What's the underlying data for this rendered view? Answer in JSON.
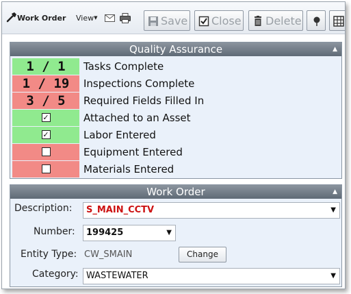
{
  "toolbar": {
    "title": "Work Order",
    "view_label": "View",
    "save_label": "Save",
    "close_label": "Close",
    "delete_label": "Delete"
  },
  "quality_assurance": {
    "title": "Quality Assurance",
    "rows": [
      {
        "value": "1 / 1",
        "label": "Tasks Complete",
        "status": "green",
        "kind": "count"
      },
      {
        "value": "1 / 19",
        "label": "Inspections Complete",
        "status": "red",
        "kind": "count"
      },
      {
        "value": "3 / 5",
        "label": "Required Fields Filled In",
        "status": "red",
        "kind": "count"
      },
      {
        "value": "☑",
        "label": "Attached to an Asset",
        "status": "green",
        "kind": "check",
        "checked": true
      },
      {
        "value": "☑",
        "label": "Labor Entered",
        "status": "green",
        "kind": "check",
        "checked": true
      },
      {
        "value": "☐",
        "label": "Equipment Entered",
        "status": "red",
        "kind": "check",
        "checked": false
      },
      {
        "value": "☐",
        "label": "Materials Entered",
        "status": "red",
        "kind": "check",
        "checked": false
      }
    ]
  },
  "work_order": {
    "title": "Work Order",
    "description_label": "Description:",
    "description_value": "S_MAIN_CCTV",
    "number_label": "Number:",
    "number_value": "199425",
    "entity_type_label": "Entity Type:",
    "entity_type_value": "CW_SMAIN",
    "change_label": "Change",
    "category_label": "Category:",
    "category_value": "WASTEWATER"
  },
  "colors": {
    "ok": "#90ea8f",
    "bad": "#f28a86",
    "description_text": "#cc1111"
  }
}
